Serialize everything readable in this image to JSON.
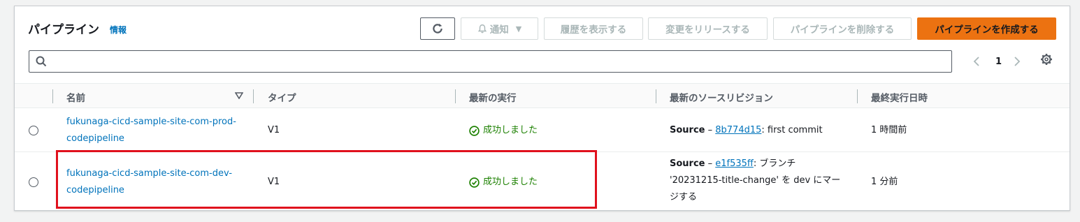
{
  "header": {
    "title": "パイプライン",
    "info_link": "情報"
  },
  "toolbar": {
    "refresh_icon": "refresh-icon",
    "notify_label": "通知",
    "history_label": "履歴を表示する",
    "release_label": "変更をリリースする",
    "delete_label": "パイプラインを削除する",
    "create_label": "パイプラインを作成する"
  },
  "search": {
    "placeholder": "",
    "value": ""
  },
  "pagination": {
    "current_page": "1"
  },
  "table": {
    "columns": [
      "名前",
      "タイプ",
      "最新の実行",
      "最新のソースリビジョン",
      "最終実行日時"
    ],
    "rows": [
      {
        "name_line1": "fukunaga-cicd-sample-site-com-prod-",
        "name_line2": "codepipeline",
        "type": "V1",
        "status": "成功しました",
        "source_label": "Source",
        "source_sep": " – ",
        "commit_id": "8b774d15",
        "commit_msg_line1": ": first commit",
        "commit_msg_line2": "",
        "commit_msg_line3": "",
        "last_run": "1 時間前"
      },
      {
        "name_line1": "fukunaga-cicd-sample-site-com-dev-",
        "name_line2": "codepipeline",
        "type": "V1",
        "status": "成功しました",
        "source_label": "Source",
        "source_sep": " – ",
        "commit_id": "e1f535ff",
        "commit_msg_line1": ": ブランチ",
        "commit_msg_line2": "'20231215-title-change' を dev にマー",
        "commit_msg_line3": "ジする",
        "last_run": "1 分前"
      }
    ]
  },
  "colors": {
    "accent": "#ec7211",
    "link": "#0073bb",
    "success": "#1d8102",
    "highlight": "#e0111d"
  }
}
